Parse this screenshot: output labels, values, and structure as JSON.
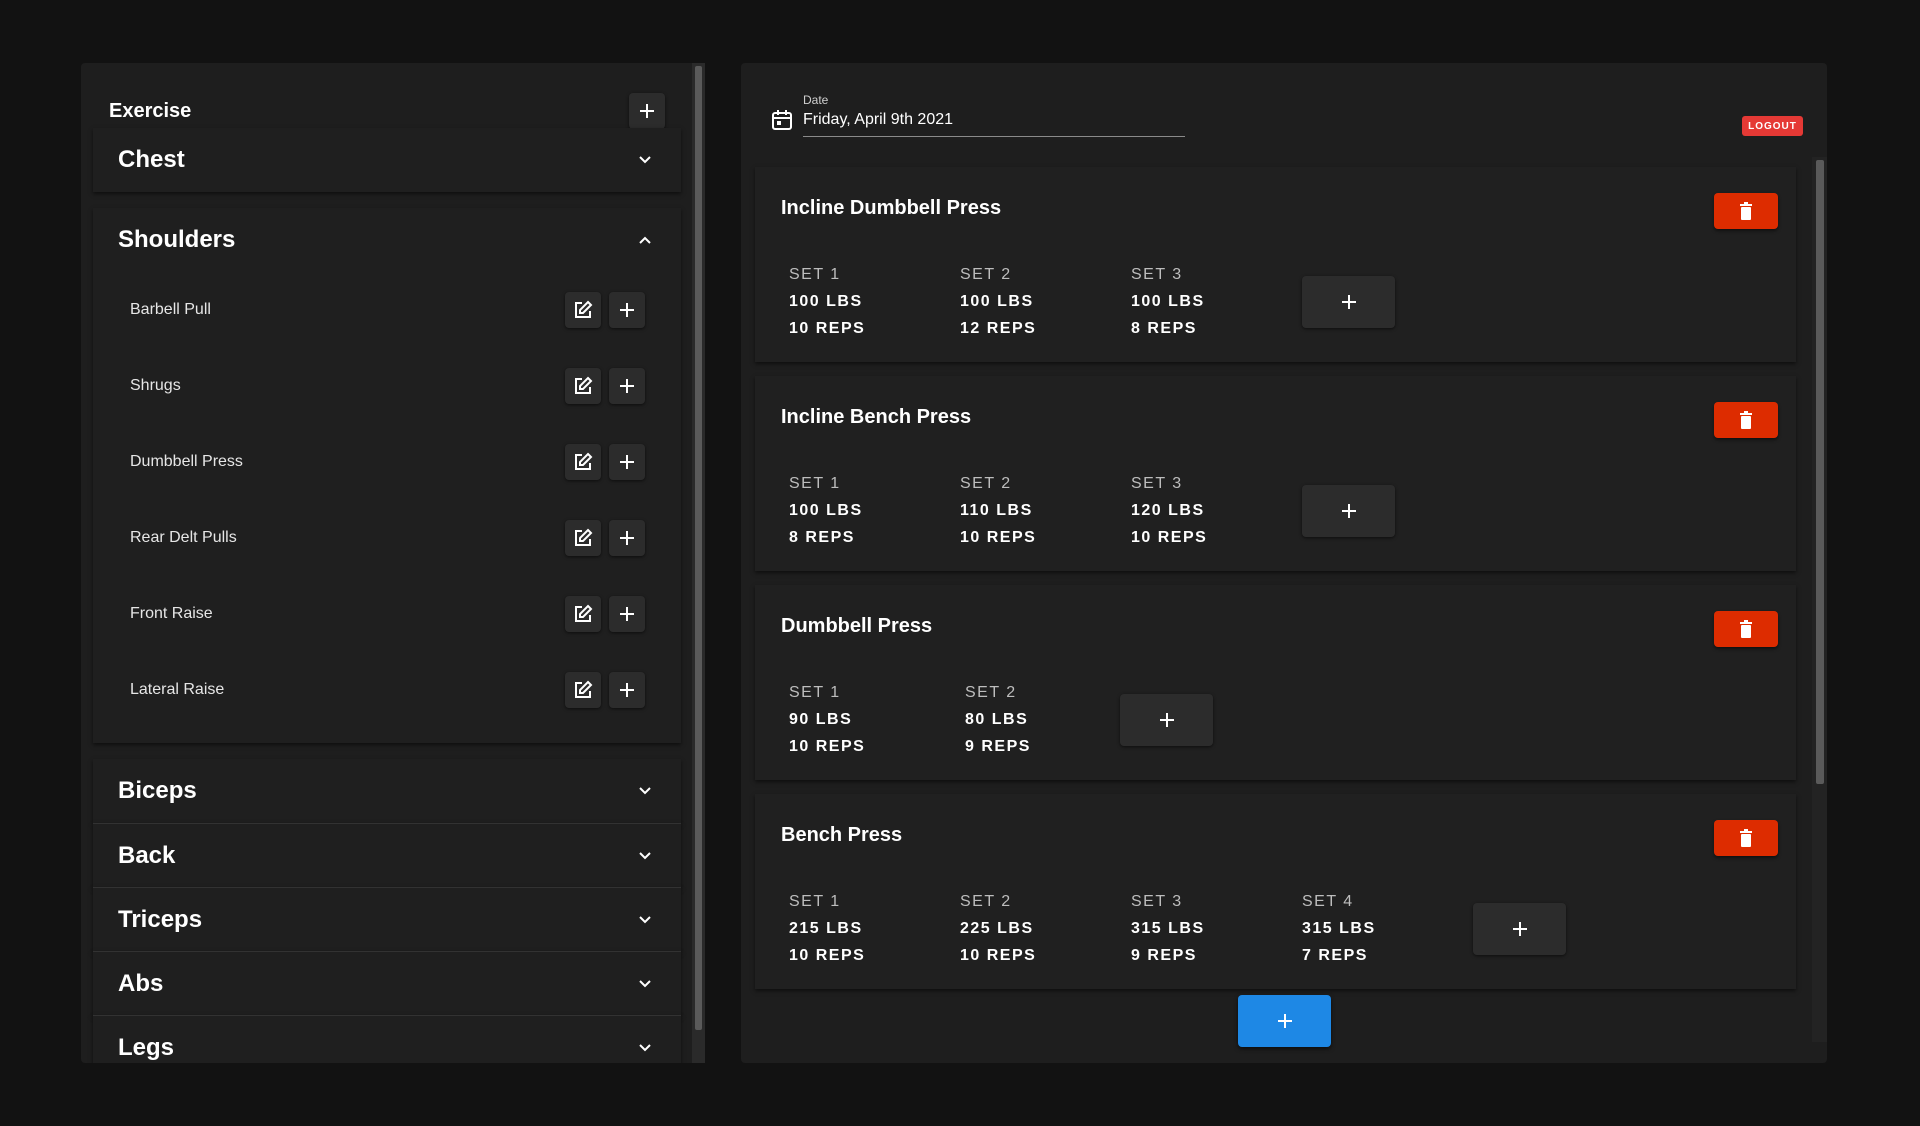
{
  "sidebar": {
    "header_title": "Exercise",
    "categories": [
      {
        "name": "Chest",
        "expanded": false
      },
      {
        "name": "Shoulders",
        "expanded": true,
        "exercises": [
          "Barbell Pull",
          "Shrugs",
          "Dumbbell Press",
          "Rear Delt Pulls",
          "Front Raise",
          "Lateral Raise"
        ]
      },
      {
        "name": "Biceps",
        "expanded": false
      },
      {
        "name": "Back",
        "expanded": false
      },
      {
        "name": "Triceps",
        "expanded": false
      },
      {
        "name": "Abs",
        "expanded": false
      },
      {
        "name": "Legs",
        "expanded": false
      }
    ]
  },
  "header": {
    "date_label": "Date",
    "date_value": "Friday, April 9th 2021",
    "logout_label": "LOGOUT"
  },
  "workout": [
    {
      "name": "Incline Dumbbell Press",
      "sets": [
        {
          "label": "SET 1",
          "weight": "100 LBS",
          "reps": "10 REPS"
        },
        {
          "label": "SET 2",
          "weight": "100 LBS",
          "reps": "12 REPS"
        },
        {
          "label": "SET 3",
          "weight": "100 LBS",
          "reps": "8 REPS"
        }
      ]
    },
    {
      "name": "Incline Bench Press",
      "sets": [
        {
          "label": "SET 1",
          "weight": "100 LBS",
          "reps": "8 REPS"
        },
        {
          "label": "SET 2",
          "weight": "110 LBS",
          "reps": "10 REPS"
        },
        {
          "label": "SET 3",
          "weight": "120 LBS",
          "reps": "10 REPS"
        }
      ]
    },
    {
      "name": "Dumbbell Press",
      "sets": [
        {
          "label": "SET 1",
          "weight": "90 LBS",
          "reps": "10 REPS"
        },
        {
          "label": "SET 2",
          "weight": "80 LBS",
          "reps": "9 REPS"
        }
      ]
    },
    {
      "name": "Bench Press",
      "sets": [
        {
          "label": "SET 1",
          "weight": "215 LBS",
          "reps": "10 REPS"
        },
        {
          "label": "SET 2",
          "weight": "225 LBS",
          "reps": "10 REPS"
        },
        {
          "label": "SET 3",
          "weight": "315 LBS",
          "reps": "9 REPS"
        },
        {
          "label": "SET 4",
          "weight": "315 LBS",
          "reps": "7 REPS"
        }
      ]
    }
  ],
  "icons": {
    "add": "plus-icon",
    "edit": "edit-icon",
    "delete": "trash-icon",
    "expand": "chevron-down-icon",
    "collapse": "chevron-up-icon",
    "calendar": "calendar-icon"
  },
  "colors": {
    "background": "#121212",
    "panel": "#1e1e1e",
    "delete": "#dd2c00",
    "logout": "#e53935",
    "primary": "#1e88e5"
  }
}
